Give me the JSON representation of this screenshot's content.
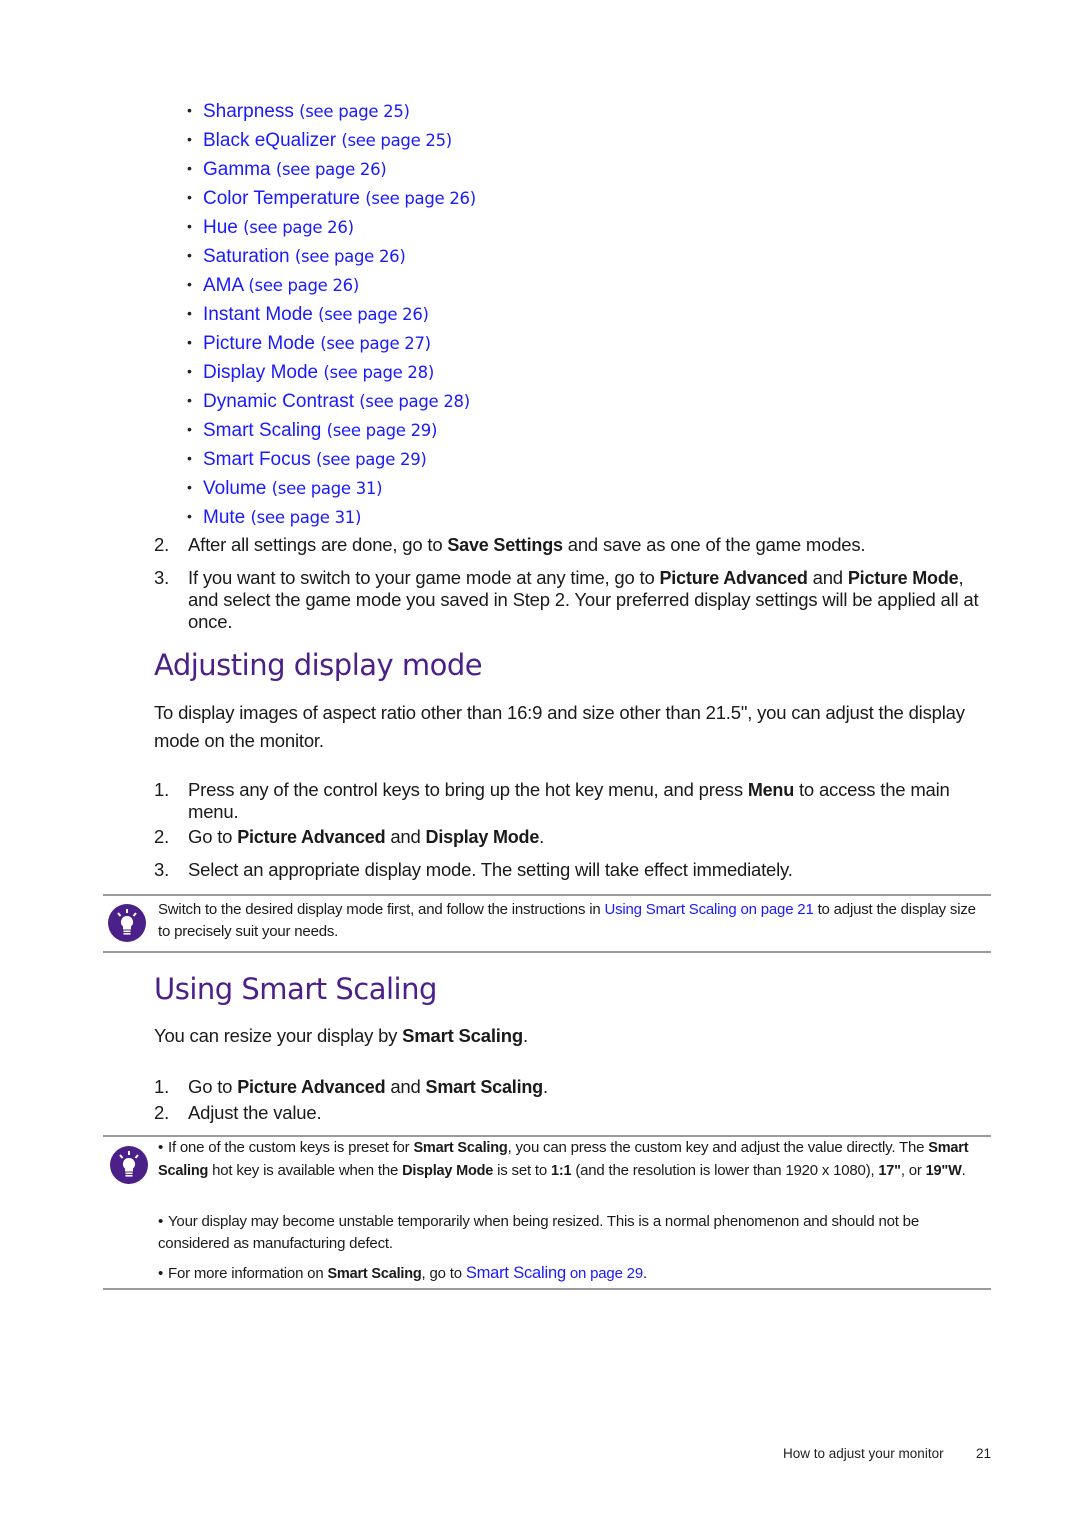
{
  "link_list": [
    {
      "label": "Sharpness",
      "ref": "(see page 25)"
    },
    {
      "label": "Black eQualizer",
      "ref": "(see page 25)"
    },
    {
      "label": "Gamma",
      "ref": "(see page 26)"
    },
    {
      "label": "Color Temperature",
      "ref": "(see page 26)"
    },
    {
      "label": "Hue",
      "ref": "(see page 26)"
    },
    {
      "label": "Saturation",
      "ref": "(see page 26)"
    },
    {
      "label": "AMA",
      "ref": "(see page 26)"
    },
    {
      "label": "Instant Mode",
      "ref": "(see page 26)"
    },
    {
      "label": "Picture Mode",
      "ref": "(see page 27)"
    },
    {
      "label": "Display Mode",
      "ref": "(see page 28)"
    },
    {
      "label": "Dynamic Contrast",
      "ref": "(see page 28)"
    },
    {
      "label": "Smart Scaling",
      "ref": "(see page 29)"
    },
    {
      "label": "Smart Focus",
      "ref": "(see page 29)"
    },
    {
      "label": "Volume",
      "ref": "(see page 31)"
    },
    {
      "label": "Mute",
      "ref": "(see page 31)"
    }
  ],
  "game_steps": {
    "step2": {
      "num": "2.",
      "t1": "After all settings are done, go to ",
      "b1": "Save Settings",
      "t2": " and save as one of the game modes."
    },
    "step3": {
      "num": "3.",
      "t1": "If you want to switch to your game mode at any time, go to ",
      "b1": "Picture Advanced",
      "t2": " and ",
      "b2": "Picture Mode",
      "t3": ", and select the game mode you saved in Step 2. Your preferred display settings will be applied all at once."
    }
  },
  "section_display_mode": {
    "title": "Adjusting display mode",
    "intro": "To display images of aspect ratio other than 16:9 and size other than 21.5\", you can adjust the display mode on the monitor.",
    "step1": {
      "num": "1.",
      "t1": "Press any of the control keys to bring up the hot key menu, and press ",
      "b1": "Menu",
      "t2": " to access the main menu."
    },
    "step2": {
      "num": "2.",
      "t1": "Go to ",
      "b1": "Picture Advanced",
      "t2": " and ",
      "b2": "Display Mode",
      "t3": "."
    },
    "step3": {
      "num": "3.",
      "t1": "Select an appropriate display mode. The setting will take effect immediately."
    },
    "tip": {
      "t1": "Switch to the desired display mode first, and follow the instructions in ",
      "link": "Using Smart Scaling on page 21",
      "t2": " to adjust the display size to precisely suit your needs."
    }
  },
  "section_smart_scaling": {
    "title": "Using Smart Scaling",
    "intro_t1": "You can resize your display by ",
    "intro_b1": "Smart Scaling",
    "intro_t2": ".",
    "step1": {
      "num": "1.",
      "t1": "Go to ",
      "b1": "Picture Advanced",
      "t2": " and ",
      "b2": "Smart Scaling",
      "t3": "."
    },
    "step2": {
      "num": "2.",
      "t1": "Adjust the value."
    },
    "tips": {
      "tip1": {
        "bullet": "•",
        "t1": "If one of the custom keys is preset for ",
        "b1": "Smart Scaling",
        "t2": ", you can press the custom key and adjust the value directly. The ",
        "b2": "Smart Scaling",
        "t3": " hot key is available when the ",
        "b3": "Display Mode",
        "t4": " is set to ",
        "b4": "1:1",
        "t5": " (and the resolution is lower than 1920 x 1080), ",
        "b5": "17\"",
        "t6": ", or ",
        "b6": "19\"W",
        "t7": "."
      },
      "tip2": {
        "bullet": "•",
        "t1": "Your display may become unstable temporarily when being resized. This is a normal phenomenon and should not be considered as manufacturing defect."
      },
      "tip3": {
        "bullet": "•",
        "t1": "For more information on ",
        "b1": "Smart Scaling",
        "t2": ", go to ",
        "link_main": "Smart Scaling",
        "link_ref": " on page 29",
        "t3": "."
      }
    }
  },
  "footer": {
    "section": "How to adjust your monitor",
    "page_number": "21"
  },
  "colors": {
    "heading": "#4b2189",
    "link": "#1a1aff",
    "tip_icon": "#4b2189",
    "rule": "#9a9a9a"
  }
}
